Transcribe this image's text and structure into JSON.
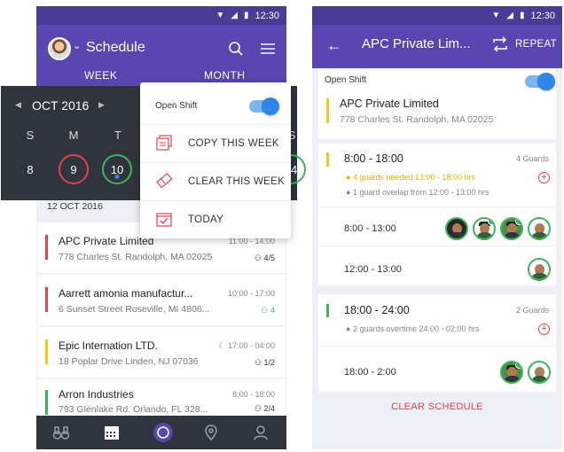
{
  "status_bar": {
    "time": "12:30"
  },
  "left": {
    "header": {
      "title": "Schedule",
      "tabs": [
        "WEEK",
        "MONTH"
      ]
    },
    "calendar": {
      "month_label": "OCT 2016",
      "weekdays": [
        "S",
        "M",
        "T",
        "S"
      ],
      "days": [
        {
          "num": "8",
          "ring": "none"
        },
        {
          "num": "9",
          "ring": "red"
        },
        {
          "num": "10",
          "ring": "green"
        },
        {
          "num": "14",
          "ring": "green"
        }
      ]
    },
    "popup": {
      "open_shift_label": "Open Shift",
      "open_shift_on": true,
      "items": [
        {
          "label": "COPY THIS WEEK",
          "icon": "copy-calendar-icon"
        },
        {
          "label": "CLEAR THIS WEEK",
          "icon": "eraser-icon"
        },
        {
          "label": "TODAY",
          "icon": "calendar-check-icon"
        }
      ]
    },
    "date_header": "12 OCT 2016",
    "list": [
      {
        "name": "APC Private Limited",
        "address": "778 Charles St. Randolph, MA 02025",
        "time": "11:00 - 14:00",
        "guards": "4/5",
        "color": "#e5404d",
        "guards_green": false,
        "night": false
      },
      {
        "name": "Aarrett amonia manufactur...",
        "address": "6 Sunset Street Roseville, MI 4806...",
        "time": "10:00 - 17:00",
        "guards": "4",
        "color": "#e5404d",
        "guards_green": true,
        "night": false
      },
      {
        "name": "Epic Internation LTD.",
        "address": "18 Poplar Drive Linden, NJ 07036",
        "time": "17:00 - 04:00",
        "guards": "1/2",
        "color": "#f5c518",
        "guards_green": false,
        "night": true
      },
      {
        "name": "Arron Industries",
        "address": "793 Glenlake Rd. Orlando, FL 328...",
        "time": "8:00 - 18:00",
        "guards": "2/4",
        "color": "#3cb55b",
        "guards_green": false,
        "night": false
      }
    ],
    "bottom_nav": [
      "binoculars-icon",
      "calendar-icon",
      "circle-logo-icon",
      "location-pin-icon",
      "person-icon"
    ]
  },
  "right": {
    "header": {
      "title": "APC Private Lim...",
      "action": "REPEAT"
    },
    "open_shift_label": "Open Shift",
    "site": {
      "name": "APC Private Limited",
      "address": "778 Charles St. Randolph, MA 02025"
    },
    "shifts": [
      {
        "range": "8:00 - 18:00",
        "guards": "4 Guards",
        "notes": [
          {
            "text": "4 guards needed 13:00 - 18:00 hrs",
            "color": "#e0b400"
          },
          {
            "text": "1 guard overlap from 12:00 - 13:00 hrs",
            "color": "#888888"
          }
        ],
        "slots": [
          {
            "range": "8:00 - 13:00",
            "avatars": 4
          },
          {
            "range": "12:00 - 13:00",
            "avatars": 1
          }
        ]
      },
      {
        "range": "18:00 - 24:00",
        "guards": "2 Guards",
        "notes": [
          {
            "text": "2 guards overtime 24:00 - 02:00 hrs",
            "color": "#888888"
          }
        ],
        "slots": [
          {
            "range": "18:00 - 2:00",
            "avatars": 2
          }
        ]
      }
    ],
    "clear_label": "CLEAR SCHEDULE"
  },
  "colors": {
    "primary": "#5a46b1",
    "dark": "#2f343d",
    "red": "#e5404d",
    "green": "#3cb55b",
    "yellow": "#f5c518",
    "blue": "#2f86e8"
  }
}
